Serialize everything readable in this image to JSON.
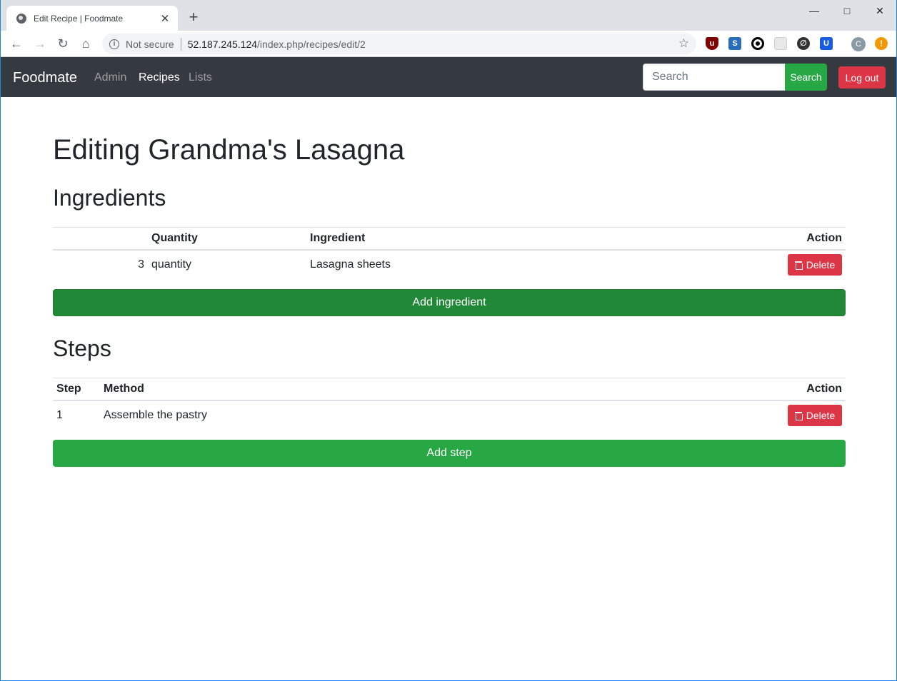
{
  "browser": {
    "tab_title": "Edit Recipe | Foodmate",
    "tab_close": "✕",
    "new_tab": "+",
    "security_label": "Not secure",
    "url_host": "52.187.245.124",
    "url_path": "/index.php/recipes/edit/2",
    "profile_initial": "C",
    "window_controls": [
      "minimize-icon",
      "maximize-icon",
      "close-icon"
    ]
  },
  "navbar": {
    "brand": "Foodmate",
    "links": [
      {
        "label": "Admin",
        "active": false
      },
      {
        "label": "Recipes",
        "active": true
      },
      {
        "label": "Lists",
        "active": false
      }
    ],
    "search_placeholder": "Search",
    "search_button": "Search",
    "logout_button": "Log out"
  },
  "page": {
    "title": "Editing Grandma's Lasagna",
    "ingredients": {
      "heading": "Ingredients",
      "columns": [
        "Quantity",
        "Ingredient",
        "Action"
      ],
      "rows": [
        {
          "amount": "3",
          "unit": "quantity",
          "ingredient": "Lasagna sheets",
          "action": "Delete"
        }
      ],
      "add_button": "Add ingredient"
    },
    "steps": {
      "heading": "Steps",
      "columns": [
        "Step",
        "Method",
        "Action"
      ],
      "rows": [
        {
          "step": "1",
          "method": "Assemble the pastry",
          "action": "Delete"
        }
      ],
      "add_button": "Add step"
    }
  },
  "colors": {
    "navbar_bg": "#343a40",
    "success": "#28a745",
    "success_dark": "#218838",
    "danger": "#dc3545"
  }
}
